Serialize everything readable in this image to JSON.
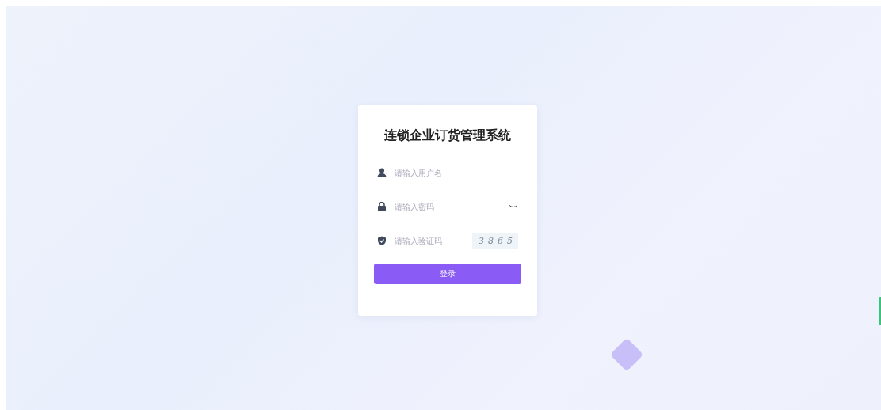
{
  "login": {
    "title": "连锁企业订货管理系统",
    "fields": [
      {
        "kind": "username",
        "placeholder": "请输入用户名"
      },
      {
        "kind": "password",
        "placeholder": "请输入密码"
      },
      {
        "kind": "captcha",
        "placeholder": "请输入验证码",
        "captcha": "3865"
      }
    ],
    "button": "登录"
  }
}
